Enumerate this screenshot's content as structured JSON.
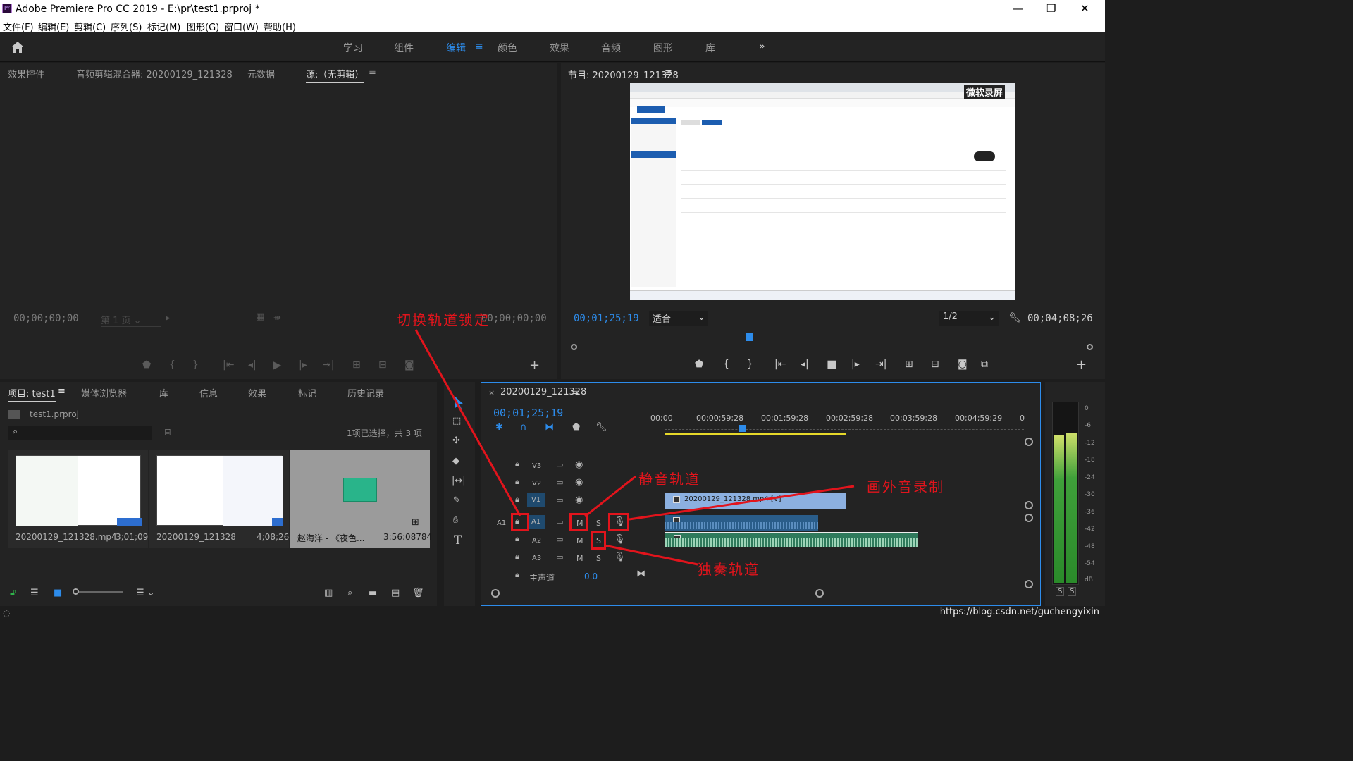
{
  "app": {
    "title": "Adobe Premiere Pro CC 2019 - E:\\pr\\test1.prproj *",
    "logo": "Pr",
    "controls": [
      "—",
      "❐",
      "✕"
    ]
  },
  "menu": [
    "文件(F)",
    "编辑(E)",
    "剪辑(C)",
    "序列(S)",
    "标记(M)",
    "图形(G)",
    "窗口(W)",
    "帮助(H)"
  ],
  "workspaces": [
    "学习",
    "组件",
    "编辑",
    "颜色",
    "效果",
    "音频",
    "图形",
    "库"
  ],
  "workspace_active": "编辑",
  "source_panel": {
    "tabs": [
      "效果控件",
      "音频剪辑混合器: 20200129_121328",
      "元数据",
      "源:（无剪辑）"
    ],
    "timecode_left": "00;00;00;00",
    "page": "第 1 页",
    "timecode_right": "00;00;00;00"
  },
  "program_panel": {
    "title": "节目: 20200129_121328",
    "timecode": "00;01;25;19",
    "fit": "适合",
    "resolution": "1/2",
    "duration": "00;04;08;26",
    "watermark": "微软录屏",
    "playhead_fraction": 0.34
  },
  "project_panel": {
    "tabs": [
      "项目: test1",
      "媒体浏览器",
      "库",
      "信息",
      "效果",
      "标记",
      "历史记录"
    ],
    "file": "test1.prproj",
    "selection": "1项已选择，共 3 项",
    "items": [
      {
        "name": "20200129_121328.mp4",
        "duration": "3;01;09"
      },
      {
        "name": "20200129_121328",
        "duration": "4;08;26"
      },
      {
        "name": "赵海洋 - 《夜色...",
        "duration": "3:56:08784"
      }
    ]
  },
  "timeline": {
    "sequence": "20200129_121328",
    "timecode": "00;01;25;19",
    "ruler": [
      "00;00",
      "00;00;59;28",
      "00;01;59;28",
      "00;02;59;28",
      "00;03;59;28",
      "00;04;59;29",
      "0"
    ],
    "video_tracks": [
      "V3",
      "V2",
      "V1"
    ],
    "audio_tracks": [
      "A1",
      "A2",
      "A3"
    ],
    "source_patch": "A1",
    "master": "主声道",
    "master_value": "0.0",
    "clip_label": "20200129_121328.mp4 [V]",
    "mute": "M",
    "solo": "S"
  },
  "meter": {
    "scale": [
      "0",
      "-6",
      "-12",
      "-18",
      "-24",
      "-30",
      "-36",
      "-42",
      "-48",
      "-54",
      "dB"
    ],
    "solo_buttons": [
      "S",
      "S"
    ]
  },
  "annotations": {
    "lock": "切换轨道锁定",
    "mute": "静音轨道",
    "voiceover": "画外音录制",
    "solo": "独奏轨道"
  },
  "footer": {
    "watermark": "https://blog.csdn.net/guchengyixin"
  },
  "colors": {
    "accent": "#2d8ceb",
    "annotation": "#e2141c",
    "clip_video": "#8cb0e0",
    "clip_audio": "#2f7a5c"
  }
}
